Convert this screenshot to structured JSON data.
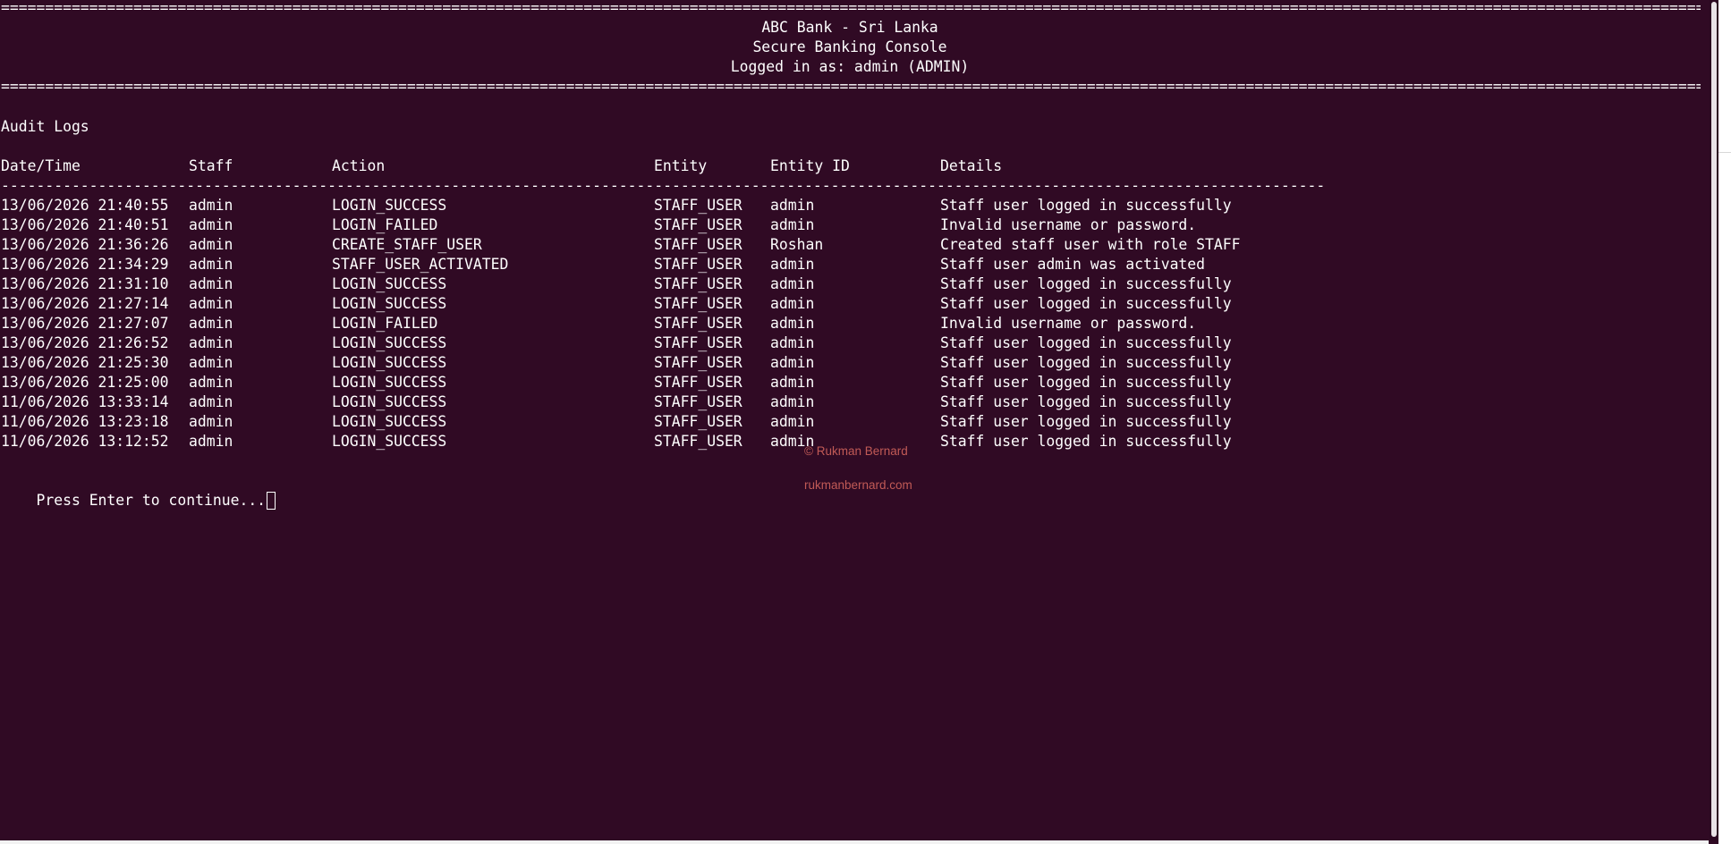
{
  "header": {
    "rule": "=====================================================================================================================================================================================================",
    "bank_name": "ABC Bank - Sri Lanka",
    "console_title": "Secure Banking Console",
    "logged_in": "Logged in as: admin (ADMIN)"
  },
  "page": {
    "title": "Audit Logs"
  },
  "table": {
    "headers": {
      "datetime": "Date/Time",
      "staff": "Staff",
      "action": "Action",
      "entity": "Entity",
      "entity_id": "Entity ID",
      "details": "Details"
    },
    "separator": "------------------------------------------------------------------------------------------------------------------------------------------------------",
    "rows": [
      {
        "datetime": "13/06/2026 21:40:55",
        "staff": "admin",
        "action": "LOGIN_SUCCESS",
        "entity": "STAFF_USER",
        "entity_id": "admin",
        "details": "Staff user logged in successfully"
      },
      {
        "datetime": "13/06/2026 21:40:51",
        "staff": "admin",
        "action": "LOGIN_FAILED",
        "entity": "STAFF_USER",
        "entity_id": "admin",
        "details": "Invalid username or password."
      },
      {
        "datetime": "13/06/2026 21:36:26",
        "staff": "admin",
        "action": "CREATE_STAFF_USER",
        "entity": "STAFF_USER",
        "entity_id": "Roshan",
        "details": "Created staff user with role STAFF"
      },
      {
        "datetime": "13/06/2026 21:34:29",
        "staff": "admin",
        "action": "STAFF_USER_ACTIVATED",
        "entity": "STAFF_USER",
        "entity_id": "admin",
        "details": "Staff user admin was activated"
      },
      {
        "datetime": "13/06/2026 21:31:10",
        "staff": "admin",
        "action": "LOGIN_SUCCESS",
        "entity": "STAFF_USER",
        "entity_id": "admin",
        "details": "Staff user logged in successfully"
      },
      {
        "datetime": "13/06/2026 21:27:14",
        "staff": "admin",
        "action": "LOGIN_SUCCESS",
        "entity": "STAFF_USER",
        "entity_id": "admin",
        "details": "Staff user logged in successfully"
      },
      {
        "datetime": "13/06/2026 21:27:07",
        "staff": "admin",
        "action": "LOGIN_FAILED",
        "entity": "STAFF_USER",
        "entity_id": "admin",
        "details": "Invalid username or password."
      },
      {
        "datetime": "13/06/2026 21:26:52",
        "staff": "admin",
        "action": "LOGIN_SUCCESS",
        "entity": "STAFF_USER",
        "entity_id": "admin",
        "details": "Staff user logged in successfully"
      },
      {
        "datetime": "13/06/2026 21:25:30",
        "staff": "admin",
        "action": "LOGIN_SUCCESS",
        "entity": "STAFF_USER",
        "entity_id": "admin",
        "details": "Staff user logged in successfully"
      },
      {
        "datetime": "13/06/2026 21:25:00",
        "staff": "admin",
        "action": "LOGIN_SUCCESS",
        "entity": "STAFF_USER",
        "entity_id": "admin",
        "details": "Staff user logged in successfully"
      },
      {
        "datetime": "11/06/2026 13:33:14",
        "staff": "admin",
        "action": "LOGIN_SUCCESS",
        "entity": "STAFF_USER",
        "entity_id": "admin",
        "details": "Staff user logged in successfully"
      },
      {
        "datetime": "11/06/2026 13:23:18",
        "staff": "admin",
        "action": "LOGIN_SUCCESS",
        "entity": "STAFF_USER",
        "entity_id": "admin",
        "details": "Staff user logged in successfully"
      },
      {
        "datetime": "11/06/2026 13:12:52",
        "staff": "admin",
        "action": "LOGIN_SUCCESS",
        "entity": "STAFF_USER",
        "entity_id": "admin",
        "details": "Staff user logged in successfully"
      }
    ]
  },
  "prompt": {
    "text": "Press Enter to continue..."
  },
  "watermark": {
    "copyright": "© Rukman Bernard",
    "website": "rukmanbernard.com"
  },
  "colors": {
    "background": "#300a24",
    "text": "#ffffff",
    "watermark": "#c15a56"
  }
}
